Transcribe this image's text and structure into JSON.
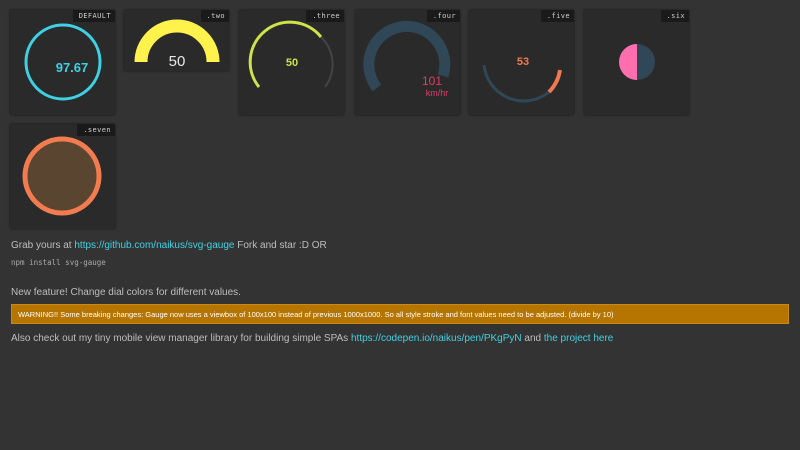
{
  "gauges": [
    {
      "tag": "DEFAULT",
      "value": "97.67",
      "color": "#3fd1e3"
    },
    {
      "tag": ".two",
      "value": "50",
      "color": "#fff24d"
    },
    {
      "tag": ".three",
      "value": "50",
      "color": "#cfe24a"
    },
    {
      "tag": ".four",
      "value": "101",
      "unit": "km/hr",
      "color": "#e23b6a"
    },
    {
      "tag": ".five",
      "value": "53",
      "color": "#ef7a52"
    },
    {
      "tag": ".six",
      "color": "#ff6fb0"
    },
    {
      "tag": ".seven",
      "color": "#f27c4f"
    }
  ],
  "text": {
    "grab_prefix": "Grab yours at ",
    "grab_link": "https://github.com/naikus/svg-gauge",
    "grab_suffix": " Fork and star :D OR",
    "npm": "npm install svg-gauge",
    "feature": "New feature! Change dial colors for different values.",
    "warning": "WARNING!! Some breaking changes: Gauge now uses a viewbox of 100x100 instead of previous 1000x1000. So all style stroke and font values need to be adjusted. (divide by 10)",
    "also_prefix": "Also check out my tiny mobile view manager library for building simple SPAs ",
    "also_link1": "https://codepen.io/naikus/pen/PKgPyN",
    "also_and": " and ",
    "also_link2": "the project here"
  }
}
